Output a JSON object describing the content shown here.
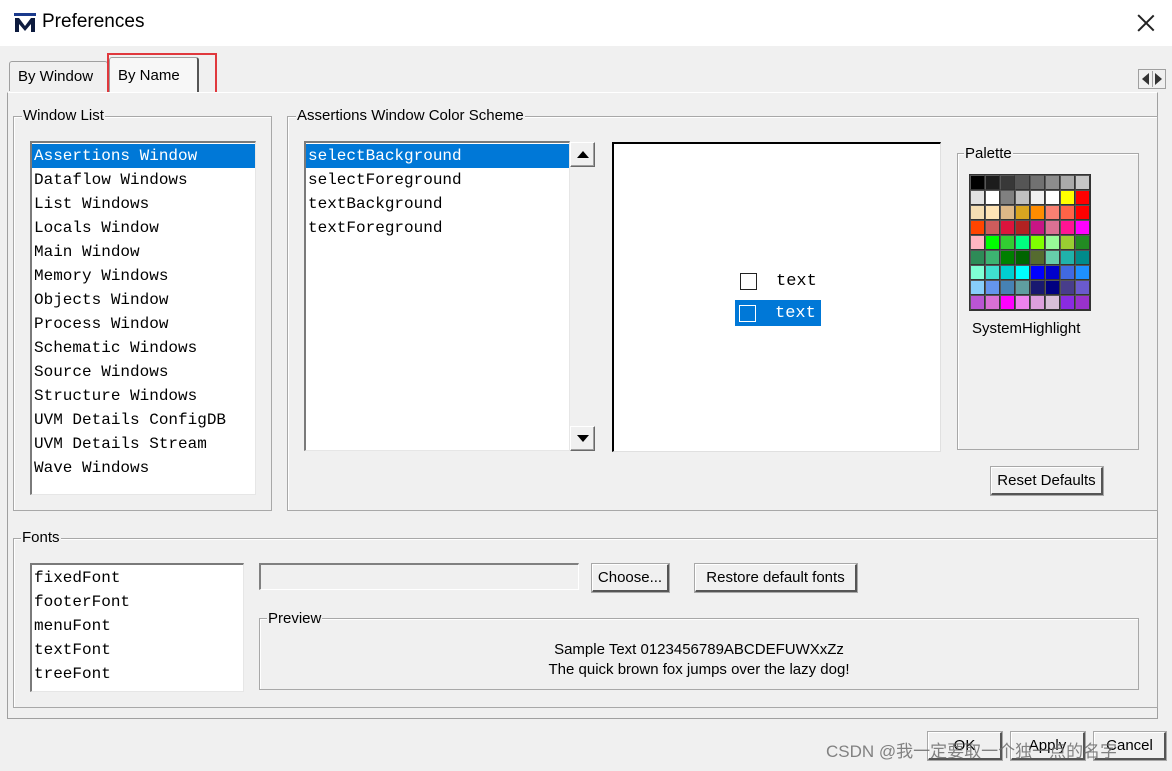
{
  "window": {
    "title": "Preferences",
    "app_icon": "modelsim-logo-icon"
  },
  "tabs": [
    {
      "label": "By Window",
      "selected": false
    },
    {
      "label": "By Name",
      "selected": true
    }
  ],
  "window_list": {
    "label": "Window List",
    "items": [
      "Assertions Window",
      "Dataflow Windows",
      "List Windows",
      "Locals Window",
      "Main Window",
      "Memory Windows",
      "Objects Window",
      "Process Window",
      "Schematic Windows",
      "Source Windows",
      "Structure Windows",
      "UVM Details ConfigDB",
      "UVM Details Stream",
      "Wave Windows"
    ],
    "selected_index": 0
  },
  "color_scheme": {
    "label": "Assertions Window Color Scheme",
    "items": [
      "selectBackground",
      "selectForeground",
      "textBackground",
      "textForeground"
    ],
    "selected_index": 0,
    "preview_rows": [
      {
        "text": "text",
        "selected": false
      },
      {
        "text": "text",
        "selected": true
      }
    ]
  },
  "palette": {
    "label": "Palette",
    "current_name": "SystemHighlight",
    "colors": [
      "#000000",
      "#1c1c1c",
      "#383838",
      "#555555",
      "#717171",
      "#8d8d8d",
      "#aaaaaa",
      "#c6c6c6",
      "#e2e2e2",
      "#ffffff",
      "#808080",
      "#c0c0c0",
      "#f0f0f0",
      "#ffffff",
      "#ffff00",
      "#ff0000",
      "#f5deb3",
      "#ffe4b5",
      "#deb887",
      "#daa520",
      "#ff8c00",
      "#fa8072",
      "#ff6347",
      "#ff0000",
      "#ff4500",
      "#cd5c5c",
      "#dc143c",
      "#b22222",
      "#c71585",
      "#db7093",
      "#ff1493",
      "#ff00ff",
      "#ffb6c1",
      "#00ff00",
      "#32cd32",
      "#00ff7f",
      "#7fff00",
      "#98fb98",
      "#9acd32",
      "#228b22",
      "#2e8b57",
      "#3cb371",
      "#008000",
      "#006400",
      "#556b2f",
      "#66cdaa",
      "#20b2aa",
      "#008b8b",
      "#7fffd4",
      "#40e0d0",
      "#00ced1",
      "#00ffff",
      "#0000ff",
      "#0000cd",
      "#4169e1",
      "#1e90ff",
      "#87cefa",
      "#6495ed",
      "#4682b4",
      "#5f9ea0",
      "#191970",
      "#000080",
      "#483d8b",
      "#6a5acd",
      "#ba55d3",
      "#da70d6",
      "#ff00ff",
      "#ee82ee",
      "#dda0dd",
      "#d8bfd8",
      "#8a2be2",
      "#9932cc"
    ],
    "reset_label": "Reset Defaults"
  },
  "fonts": {
    "label": "Fonts",
    "items": [
      "fixedFont",
      "footerFont",
      "menuFont",
      "textFont",
      "treeFont"
    ],
    "font_value": "",
    "choose_label": "Choose...",
    "restore_label": "Restore default fonts",
    "preview_label": "Preview",
    "sample_line1": "Sample Text 0123456789ABCDEFUWXxZz",
    "sample_line2": "The quick brown fox jumps over the lazy dog!"
  },
  "buttons": {
    "ok": "OK",
    "apply": "Apply",
    "cancel": "Cancel"
  },
  "watermark": "CSDN @我一定要取一个独一点的名字"
}
